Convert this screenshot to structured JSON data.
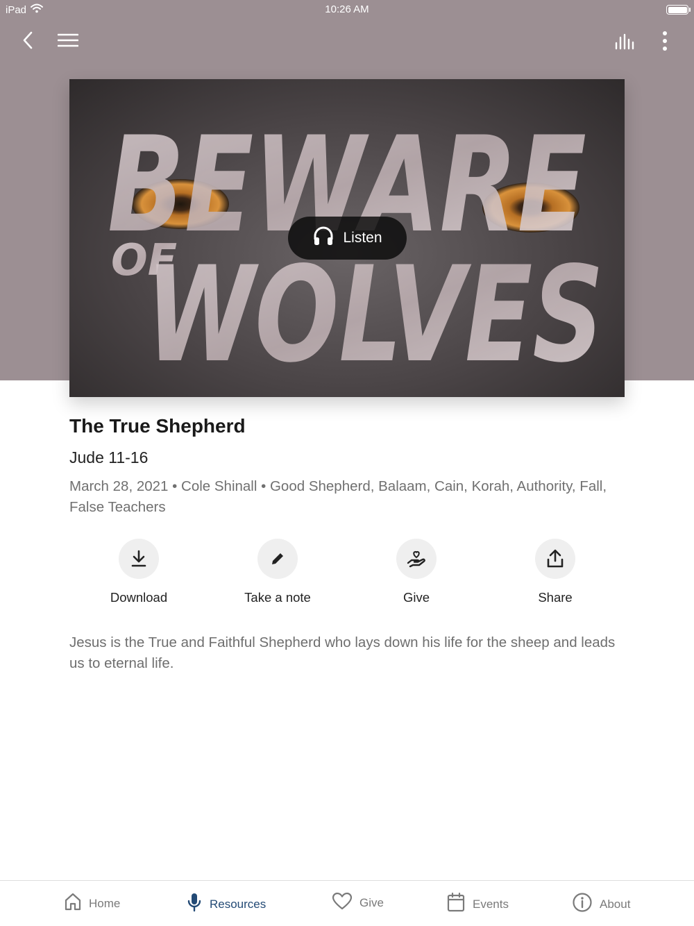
{
  "status_bar": {
    "device": "iPad",
    "time": "10:26 AM",
    "battery_level": 1.0,
    "icons": [
      "wifi-icon",
      "battery-icon"
    ]
  },
  "nav_bar": {
    "icons": [
      "back-chevron-icon",
      "hamburger-menu-icon",
      "audio-bars-icon",
      "more-vertical-icon"
    ]
  },
  "artwork": {
    "artwork_text": [
      "BEWARE",
      "OF",
      "WOLVES"
    ],
    "listen_label": "Listen",
    "listen_icon": "headphones-icon"
  },
  "sermon": {
    "title": "The True Shepherd",
    "scripture": "Jude 11-16",
    "meta": "March 28, 2021 • Cole Shinall • Good Shepherd, Balaam, Cain, Korah, Authority, Fall, False Teachers",
    "description": "Jesus is the True and Faithful Shepherd who lays down his life for the sheep and leads us to eternal life."
  },
  "actions": [
    {
      "label": "Download",
      "icon": "download-icon"
    },
    {
      "label": "Take a note",
      "icon": "pencil-icon"
    },
    {
      "label": "Give",
      "icon": "giving-hand-heart-icon"
    },
    {
      "label": "Share",
      "icon": "share-upload-icon"
    }
  ],
  "tabs": [
    {
      "label": "Home",
      "icon": "home-icon",
      "active": false
    },
    {
      "label": "Resources",
      "icon": "microphone-icon",
      "active": true
    },
    {
      "label": "Give",
      "icon": "heart-icon",
      "active": false
    },
    {
      "label": "Events",
      "icon": "calendar-icon",
      "active": false
    },
    {
      "label": "About",
      "icon": "info-icon",
      "active": false
    }
  ],
  "colors": {
    "header_background": "#9c8f93",
    "active_tab": "#234a75",
    "inactive_tab": "#7a7a7a",
    "action_circle": "#efefef"
  }
}
